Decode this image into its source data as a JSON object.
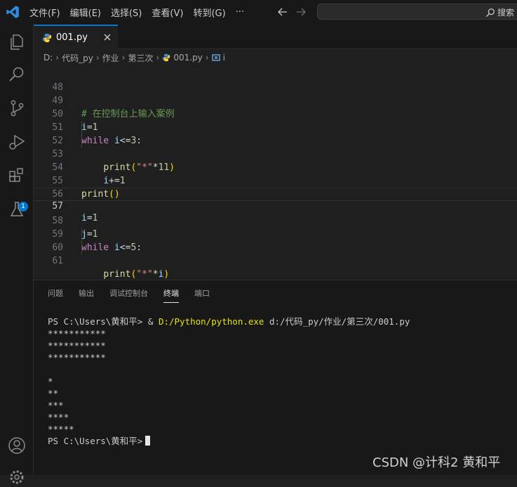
{
  "menu": {
    "items": [
      "文件(F)",
      "编辑(E)",
      "选择(S)",
      "查看(V)",
      "转到(G)",
      "···"
    ],
    "search_label": "搜索"
  },
  "tab": {
    "name": "001.py"
  },
  "breadcrumb": {
    "parts": [
      "D:",
      "代码_py",
      "作业",
      "第三次",
      "001.py",
      "i"
    ]
  },
  "activity": {
    "extensions_badge": "1"
  },
  "editor": {
    "lines": [
      {
        "n": "48",
        "code": ""
      },
      {
        "n": "49",
        "code": "# 在控制台上输入案例"
      },
      {
        "n": "50",
        "code": "i=1"
      },
      {
        "n": "51",
        "code": "while i<=3:"
      },
      {
        "n": "52",
        "code": "    print(\"*\"*11)"
      },
      {
        "n": "53",
        "code": "    i+=1"
      },
      {
        "n": "54",
        "code": ""
      },
      {
        "n": "55",
        "code": "print()"
      },
      {
        "n": "56",
        "code": ""
      },
      {
        "n": "57",
        "code": "i=1"
      },
      {
        "n": "58",
        "code": "j=1"
      },
      {
        "n": "59",
        "code": "while i<=5:"
      },
      {
        "n": "60",
        "code": "    print(\"*\"*i)"
      },
      {
        "n": "61",
        "code": "    i+=1"
      }
    ],
    "current_line": "57"
  },
  "panel": {
    "tabs": [
      "问题",
      "输出",
      "调试控制台",
      "终端",
      "端口"
    ],
    "active_tab": "终端"
  },
  "terminal": {
    "prompt": "PS C:\\Users\\黄和平>",
    "command_amp": "&",
    "command_exe": "D:/Python/python.exe",
    "command_arg": "d:/代码_py/作业/第三次/001.py",
    "output": [
      "***********",
      "***********",
      "***********",
      "",
      "*",
      "**",
      "***",
      "****",
      "*****"
    ],
    "final_prompt": "PS C:\\Users\\黄和平>"
  },
  "watermark": "CSDN @计科2 黄和平",
  "colors": {
    "accent": "#0078d4",
    "background": "#1f1f1f",
    "string": "#ce9178",
    "keyword": "#c586c0"
  }
}
